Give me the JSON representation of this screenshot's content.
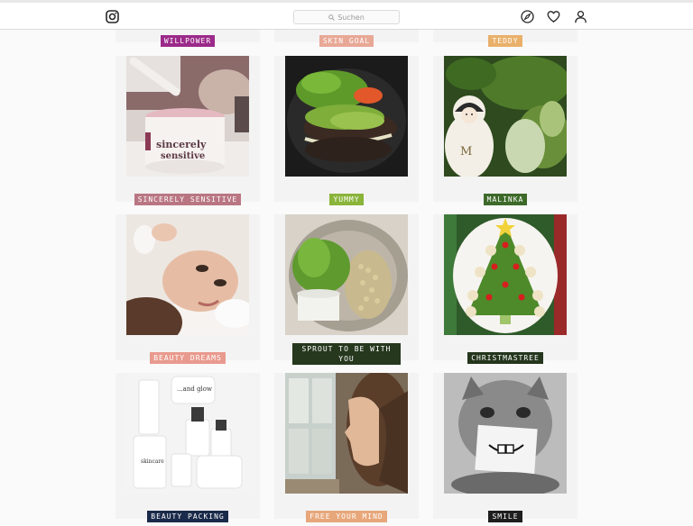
{
  "search": {
    "placeholder": "Suchen"
  },
  "colors": {
    "topbar_border": "#dbdbdb",
    "page_bg": "#fafafa"
  },
  "posts": [
    {
      "caption": "WILLPOWER",
      "tag_color": "#9b2a8a"
    },
    {
      "caption": "SKIN GOAL",
      "tag_color": "#e8a896"
    },
    {
      "caption": "TEDDY",
      "tag_color": "#e9b06a"
    },
    {
      "caption": "SINCERELY SENSITIVE",
      "tag_color": "#b97682"
    },
    {
      "caption": "YUMMY",
      "tag_color": "#8ab43a"
    },
    {
      "caption": "MALINKA",
      "tag_color": "#3d6a2a"
    },
    {
      "caption": "BEAUTY DREAMS",
      "tag_color": "#e99a8e"
    },
    {
      "caption": "SPROUT TO BE WITH YOU",
      "tag_color": "#26381e"
    },
    {
      "caption": "CHRISTMASTREE",
      "tag_color": "#24361c"
    },
    {
      "caption": "BEAUTY PACKING",
      "tag_color": "#1a2a4a"
    },
    {
      "caption": "FREE YOUR MIND",
      "tag_color": "#e7a77a"
    },
    {
      "caption": "SMILE",
      "tag_color": "#1e1e1e"
    }
  ]
}
